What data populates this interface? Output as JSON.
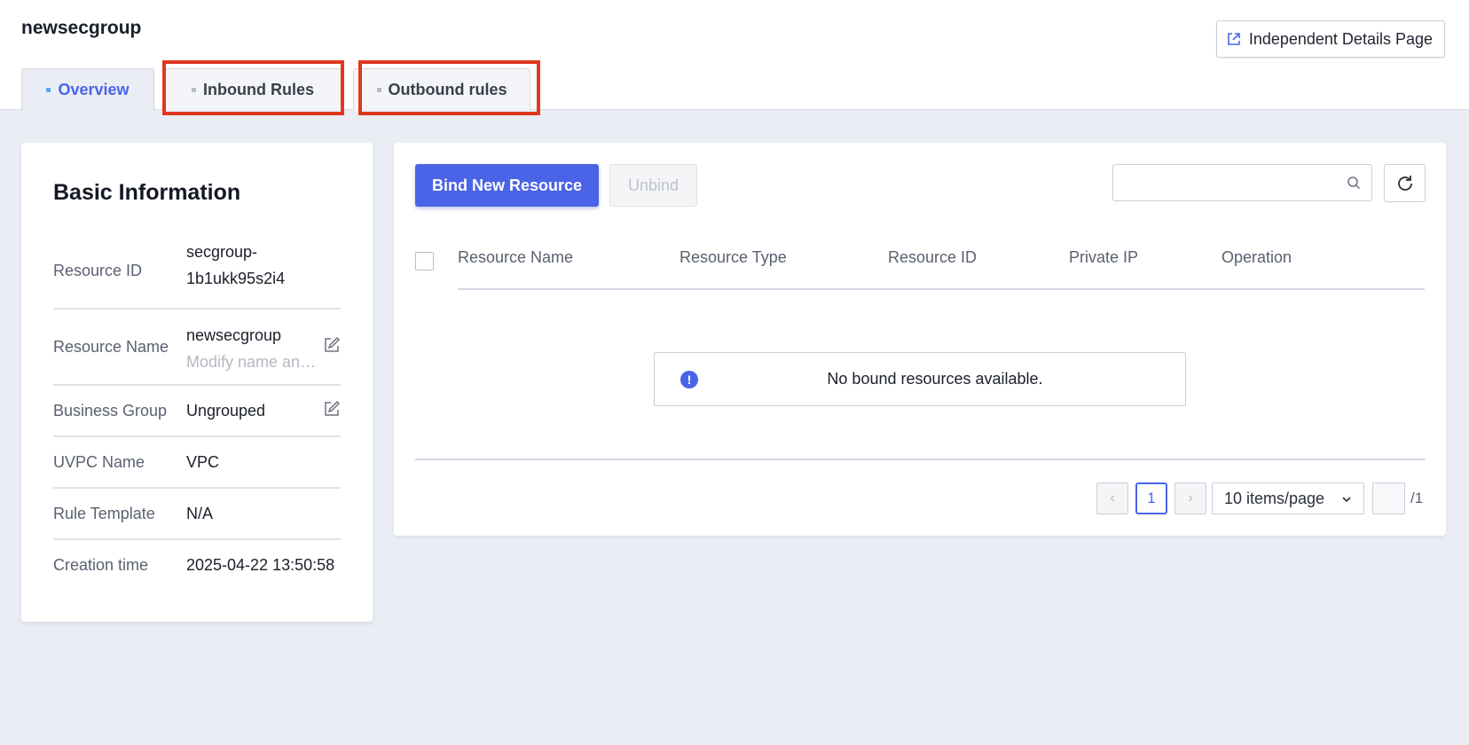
{
  "header": {
    "title": "newsecgroup",
    "details_button": "Independent Details Page"
  },
  "tabs": [
    {
      "label": "Overview",
      "active": true
    },
    {
      "label": "Inbound Rules",
      "active": false
    },
    {
      "label": "Outbound rules",
      "active": false
    }
  ],
  "basic_info": {
    "title": "Basic Information",
    "rows": [
      {
        "label": "Resource ID",
        "value": "secgroup-",
        "value2": "1b1ukk95s2i4"
      },
      {
        "label": "Resource Name",
        "value": "newsecgroup",
        "sub": "Modify name and remark"
      },
      {
        "label": "Business Group",
        "value": "Ungrouped"
      },
      {
        "label": "UVPC Name",
        "value": "VPC"
      },
      {
        "label": "Rule Template",
        "value": "N/A"
      },
      {
        "label": "Creation time",
        "value": "2025-04-22 13:50:58"
      }
    ]
  },
  "toolbar": {
    "bind_label": "Bind New Resource",
    "unbind_label": "Unbind",
    "search_placeholder": ""
  },
  "table": {
    "columns": [
      "Resource Name",
      "Resource Type",
      "Resource ID",
      "Private IP",
      "Operation"
    ],
    "empty_text": "No bound resources available."
  },
  "pagination": {
    "prev": "‹",
    "next": "›",
    "current_page": "1",
    "page_size": "10 items/page",
    "total": "/1"
  },
  "colors": {
    "accent": "#4b63e6",
    "highlight": "#e0381f",
    "background": "#ebedf4"
  }
}
